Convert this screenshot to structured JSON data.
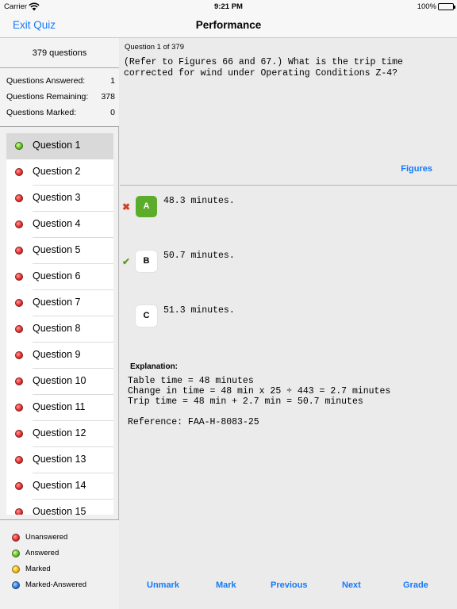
{
  "status_bar": {
    "carrier": "Carrier",
    "time": "9:21 PM",
    "battery": "100%"
  },
  "navbar": {
    "exit_label": "Exit Quiz",
    "title": "Performance"
  },
  "sidebar": {
    "count_label": "379 questions",
    "stats": [
      {
        "label": "Questions Answered:",
        "value": "1"
      },
      {
        "label": "Questions Remaining:",
        "value": "378"
      },
      {
        "label": "Questions Marked:",
        "value": "0"
      }
    ],
    "questions": [
      {
        "label": "Question 1",
        "state": "answered",
        "selected": true
      },
      {
        "label": "Question 2",
        "state": "unanswered"
      },
      {
        "label": "Question 3",
        "state": "unanswered"
      },
      {
        "label": "Question 4",
        "state": "unanswered"
      },
      {
        "label": "Question 5",
        "state": "unanswered"
      },
      {
        "label": "Question 6",
        "state": "unanswered"
      },
      {
        "label": "Question 7",
        "state": "unanswered"
      },
      {
        "label": "Question 8",
        "state": "unanswered"
      },
      {
        "label": "Question 9",
        "state": "unanswered"
      },
      {
        "label": "Question 10",
        "state": "unanswered"
      },
      {
        "label": "Question 11",
        "state": "unanswered"
      },
      {
        "label": "Question 12",
        "state": "unanswered"
      },
      {
        "label": "Question 13",
        "state": "unanswered"
      },
      {
        "label": "Question 14",
        "state": "unanswered"
      },
      {
        "label": "Question 15",
        "state": "unanswered"
      }
    ],
    "legend": [
      {
        "label": "Unanswered",
        "color": "red"
      },
      {
        "label": "Answered",
        "color": "green"
      },
      {
        "label": "Marked",
        "color": "yellow"
      },
      {
        "label": "Marked-Answered",
        "color": "blue"
      }
    ]
  },
  "question": {
    "number_label": "Question 1 of 379",
    "text": "(Refer to Figures 66 and 67.) What is the trip time corrected for wind under Operating Conditions Z-4?",
    "figures_label": "Figures"
  },
  "answers": [
    {
      "letter": "A",
      "text": "48.3 minutes.",
      "chosen": true,
      "result": "incorrect",
      "result_icon": "cross-icon"
    },
    {
      "letter": "B",
      "text": "50.7 minutes.",
      "chosen": false,
      "result": "correct",
      "result_icon": "checkmark-icon"
    },
    {
      "letter": "C",
      "text": "51.3 minutes.",
      "chosen": false,
      "result": "",
      "result_icon": ""
    }
  ],
  "explanation": {
    "title": "Explanation:",
    "lines": [
      "Table time = 48 minutes",
      "Change in time = 48 min x 25 ÷ 443 = 2.7 minutes",
      "Trip time = 48 min + 2.7 min = 50.7 minutes"
    ],
    "reference": "Reference: FAA-H-8083-25"
  },
  "toolbar": {
    "unmark_label": "Unmark",
    "mark_label": "Mark",
    "previous_label": "Previous",
    "next_label": "Next",
    "grade_label": "Grade"
  },
  "colors": {
    "accent": "#1479fb",
    "chosen_answer": "#5cac2c",
    "correct_mark": "#5c9d22",
    "incorrect_mark": "#d83c1f"
  }
}
